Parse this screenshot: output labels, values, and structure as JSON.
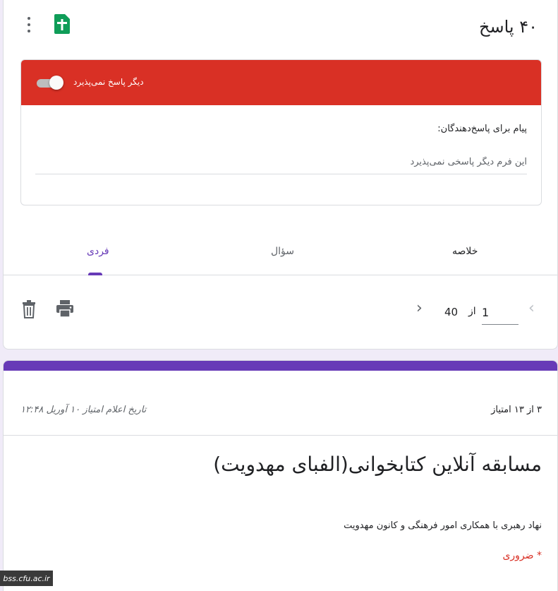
{
  "header": {
    "response_count_title": "۴۰ پاسخ"
  },
  "accepting_panel": {
    "toggle_label": "دیگر پاسخ نمی‌پذیرد",
    "message_label": "پیام برای پاسخ‌دهندگان:",
    "message_value": "این فرم دیگر پاسخی نمی‌پذیرد",
    "header_color": "#d93025"
  },
  "tabs": {
    "summary": "خلاصه",
    "question": "سؤال",
    "individual": "فردی",
    "active": "individual"
  },
  "pager": {
    "current": "1",
    "of_label": "از",
    "total": "40"
  },
  "response": {
    "score": "۳ از ۱۳ امتیاز",
    "released": "تاریخ اعلام امتیاز ۱۰ آوریل ۱۲:۴۸",
    "form_title": "مسابقه آنلاین کتابخوانی(الفبای مهدویت)",
    "form_description": "نهاد رهبری با همکاری امور فرهنگی و کانون مهدویت",
    "required_note": "* ضروری"
  },
  "watermark": "bss.cfu.ac.ir",
  "colors": {
    "accent": "#673ab7",
    "alert": "#d93025",
    "background": "#f0ebf8"
  },
  "icons": {
    "menu": "more-vert-icon",
    "sheets": "google-sheets-icon",
    "delete": "trash-icon",
    "print": "printer-icon",
    "prev": "chevron-left-icon",
    "next": "chevron-right-icon"
  }
}
